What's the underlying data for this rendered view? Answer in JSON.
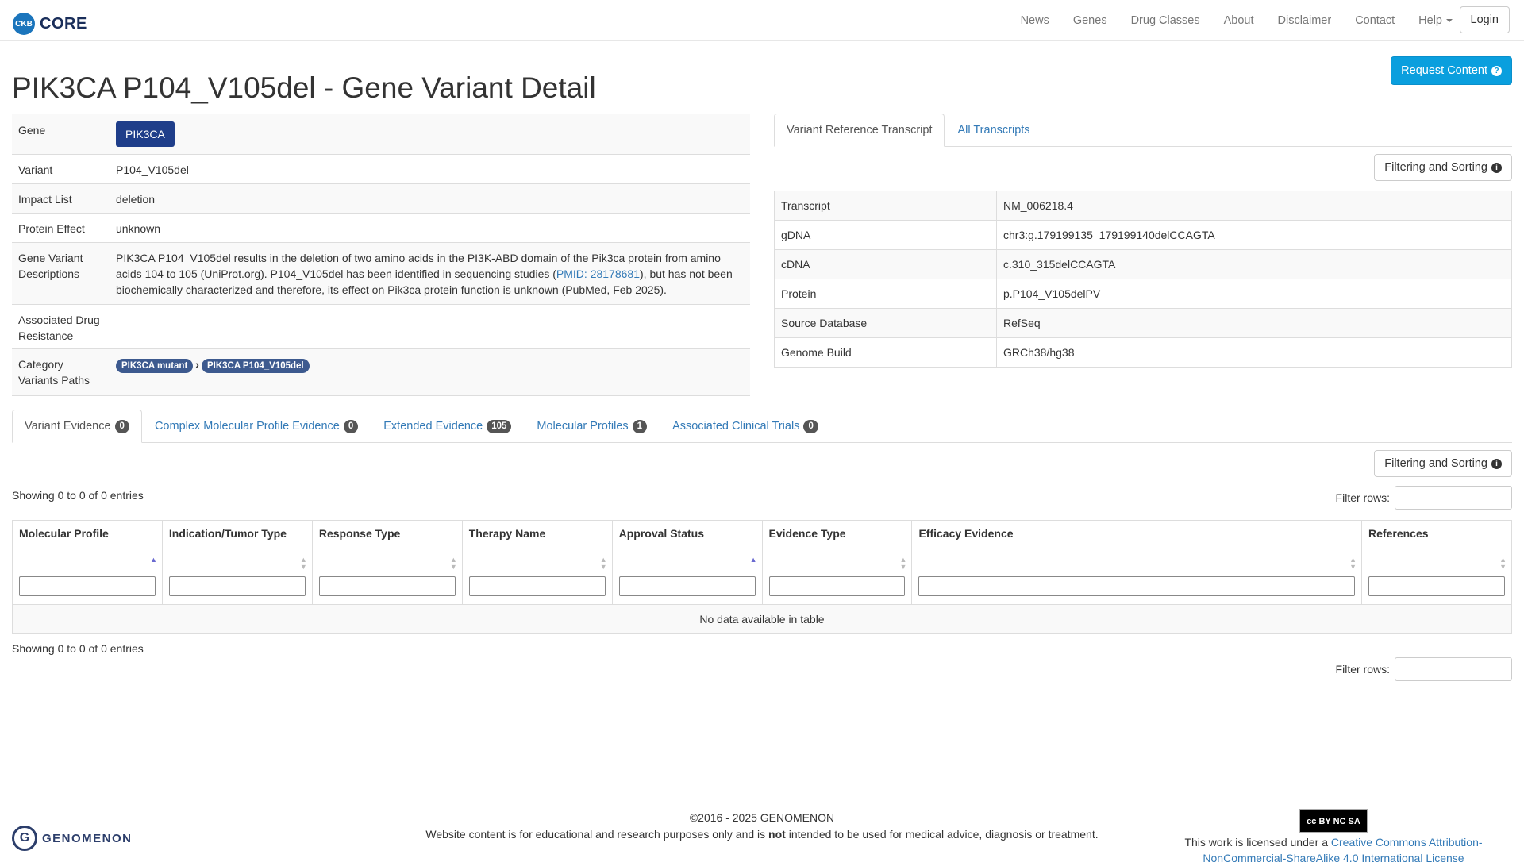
{
  "navbar": {
    "logo_abbr": "CKB",
    "brand": "CORE",
    "links": [
      "News",
      "Genes",
      "Drug Classes",
      "About",
      "Disclaimer",
      "Contact",
      "Help"
    ],
    "login": "Login"
  },
  "header": {
    "title": "PIK3CA P104_V105del - Gene Variant Detail",
    "request_button": "Request Content"
  },
  "detail": {
    "gene_label": "Gene",
    "gene_value": "PIK3CA",
    "variant_label": "Variant",
    "variant_value": "P104_V105del",
    "impact_label": "Impact List",
    "impact_value": "deletion",
    "protein_effect_label": "Protein Effect",
    "protein_effect_value": "unknown",
    "descriptions_label": "Gene Variant Descriptions",
    "description_part1": "PIK3CA P104_V105del results in the deletion of two amino acids in the PI3K-ABD domain of the Pik3ca protein from amino acids 104 to 105 (UniProt.org). P104_V105del has been identified in sequencing studies (",
    "description_link": "PMID: 28178681",
    "description_part2": "), but has not been biochemically characterized and therefore, its effect on Pik3ca protein function is unknown (PubMed, Feb 2025).",
    "drug_resistance_label": "Associated Drug Resistance",
    "category_label": "Category Variants Paths",
    "category_paths": [
      "PIK3CA mutant",
      "PIK3CA P104_V105del"
    ]
  },
  "transcripts": {
    "tabs": [
      "Variant Reference Transcript",
      "All Transcripts"
    ],
    "filter_button": "Filtering and Sorting",
    "rows": [
      {
        "label": "Transcript",
        "value": "NM_006218.4"
      },
      {
        "label": "gDNA",
        "value": "chr3:g.179199135_179199140delCCAGTA"
      },
      {
        "label": "cDNA",
        "value": "c.310_315delCCAGTA"
      },
      {
        "label": "Protein",
        "value": "p.P104_V105delPV"
      },
      {
        "label": "Source Database",
        "value": "RefSeq"
      },
      {
        "label": "Genome Build",
        "value": "GRCh38/hg38"
      }
    ]
  },
  "evidence": {
    "tabs": [
      {
        "label": "Variant Evidence",
        "count": "0"
      },
      {
        "label": "Complex Molecular Profile Evidence",
        "count": "0"
      },
      {
        "label": "Extended Evidence",
        "count": "105"
      },
      {
        "label": "Molecular Profiles",
        "count": "1"
      },
      {
        "label": "Associated Clinical Trials",
        "count": "0"
      }
    ],
    "filter_button": "Filtering and Sorting",
    "showing_top": "Showing 0 to 0 of 0 entries",
    "showing_bottom": "Showing 0 to 0 of 0 entries",
    "filter_rows_label": "Filter rows:",
    "columns": [
      "Molecular Profile",
      "Indication/Tumor Type",
      "Response Type",
      "Therapy Name",
      "Approval Status",
      "Evidence Type",
      "Efficacy Evidence",
      "References"
    ],
    "empty_message": "No data available in table"
  },
  "footer": {
    "company": "GENOMENON",
    "copyright": "©2016 - 2025 GENOMENON",
    "disclaimer_part1": "Website content is for educational and research purposes only and is ",
    "disclaimer_bold": "not",
    "disclaimer_part2": " intended to be used for medical advice, diagnosis or treatment.",
    "cc_badge": "cc BY NC SA",
    "license_prefix": "This work is licensed under a ",
    "license_link": "Creative Commons Attribution-NonCommercial-ShareAlike 4.0 International License"
  }
}
